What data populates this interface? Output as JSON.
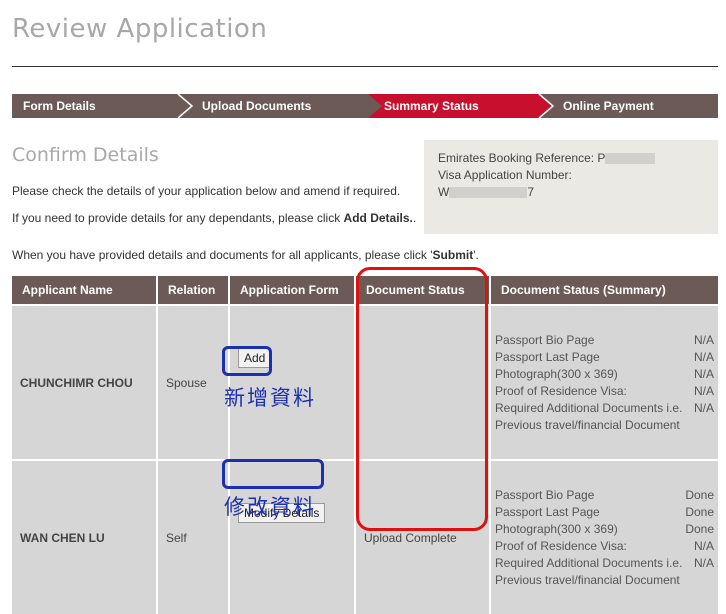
{
  "page": {
    "title": "Review Application"
  },
  "steps": [
    {
      "label": "Form Details",
      "active": false
    },
    {
      "label": "Upload Documents",
      "active": false
    },
    {
      "label": "Summary Status",
      "active": true
    },
    {
      "label": "Online Payment",
      "active": false
    }
  ],
  "confirm": {
    "title": "Confirm Details",
    "line1": "Please check the details of your application below and amend if required.",
    "line2_prefix": "If you need to provide details for any dependants, please click ",
    "line2_bold": "Add Details.",
    "line2_suffix": ".",
    "line3_prefix": "When you have provided details and documents for all applicants, please click '",
    "line3_bold": "Submit",
    "line3_suffix": "'."
  },
  "reference": {
    "booking_label": "Emirates Booking Reference: P",
    "visa_label": "Visa Application Number:",
    "visa_prefix": "W",
    "visa_suffix": "7"
  },
  "table": {
    "headers": [
      "Applicant Name",
      "Relation",
      "Application Form",
      "Document Status",
      "Document Status (Summary)"
    ],
    "rows": [
      {
        "name": "CHUNCHIMR CHOU",
        "relation": "Spouse",
        "action": "Add",
        "document_status": "",
        "summary": [
          {
            "doc": "Passport Bio Page",
            "status": "N/A"
          },
          {
            "doc": "Passport Last Page",
            "status": "N/A"
          },
          {
            "doc": "Photograph(300 x 369)",
            "status": "N/A"
          },
          {
            "doc": "Proof of Residence Visa:",
            "status": "N/A"
          },
          {
            "doc": "Required Additional Documents i.e.",
            "status": "N/A"
          },
          {
            "doc": "Previous travel/financial Document",
            "status": ""
          }
        ]
      },
      {
        "name": "WAN CHEN LU",
        "relation": "Self",
        "action": "Modify Details",
        "document_status": "Upload Complete",
        "summary": [
          {
            "doc": "Passport Bio Page",
            "status": "Done"
          },
          {
            "doc": "Passport Last Page",
            "status": "Done"
          },
          {
            "doc": "Photograph(300 x 369)",
            "status": "Done"
          },
          {
            "doc": "Proof of Residence Visa:",
            "status": "N/A"
          },
          {
            "doc": "Required Additional Documents i.e.",
            "status": "N/A"
          },
          {
            "doc": "Previous travel/financial Document",
            "status": ""
          }
        ]
      }
    ]
  },
  "annotations": {
    "add_note": "新增資料",
    "modify_note": "修改資料",
    "highlight_color": "#e01010",
    "note_color": "#1c2fb0"
  },
  "colors": {
    "bar": "#6b5a55",
    "active_step": "#c8102e",
    "cell": "#d6d6d6",
    "ref_box": "#ebe9e4"
  }
}
